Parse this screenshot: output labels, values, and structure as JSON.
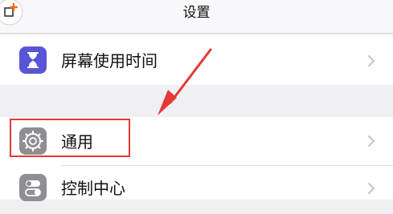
{
  "nav": {
    "title": "设置",
    "left_icon": "add-widget-icon"
  },
  "rows": [
    {
      "label": "屏幕使用时间",
      "icon": "hourglass-icon",
      "icon_color": "#5856d6"
    },
    {
      "label": "通用",
      "icon": "gear-icon",
      "icon_color": "#8e8e93"
    },
    {
      "label": "控制中心",
      "icon": "toggles-icon",
      "icon_color": "#8e8e93"
    }
  ],
  "annotation": {
    "highlight_color": "#e53935",
    "arrow_color": "#e53935"
  },
  "colors": {
    "background": "#efeff4",
    "cell": "#ffffff",
    "chevron": "#c4c4c8"
  }
}
